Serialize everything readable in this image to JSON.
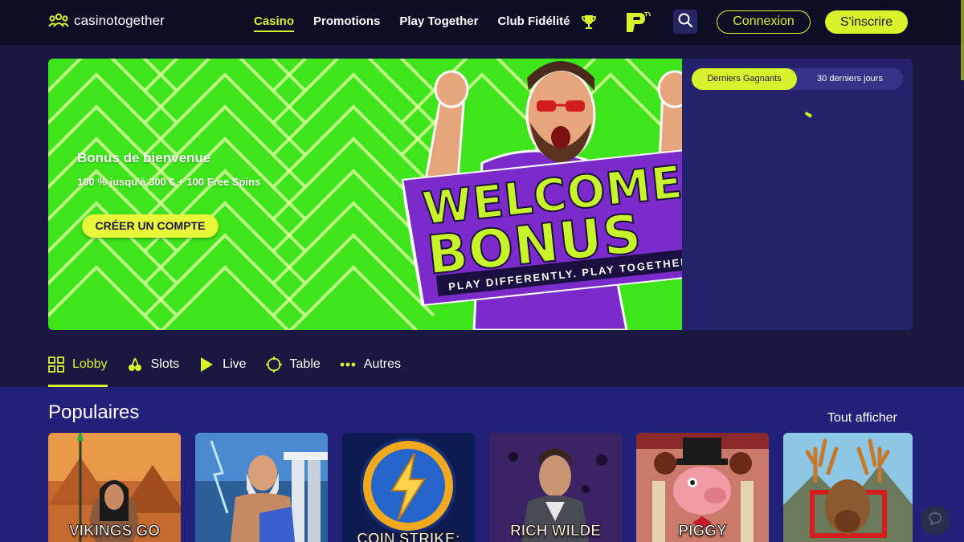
{
  "header": {
    "logo_text": "casinotogether",
    "nav": [
      "Casino",
      "Promotions",
      "Play Together",
      "Club Fidélité"
    ],
    "active_nav": "Casino",
    "login_label": "Connexion",
    "signup_label": "S'inscrire",
    "icons": [
      "logo-people-icon",
      "trophy-icon",
      "ptv-logo-icon",
      "search-icon"
    ]
  },
  "hero": {
    "title": "Bonus de bienvenue",
    "subtitle": "100 % jusqu'à 300 € + 100 Free Spins",
    "cta_label": "CRÉER UN COMPTE",
    "art_line1": "WELCOME",
    "art_line2": "BONUS",
    "art_tagline": "PLAY DIFFERENTLY. PLAY TOGETHER"
  },
  "winners": {
    "tab_active": "Derniers Gagnants",
    "tab_other": "30 derniers jours"
  },
  "categories": [
    {
      "label": "Lobby",
      "icon": "grid-icon",
      "active": true
    },
    {
      "label": "Slots",
      "icon": "cherries-icon",
      "active": false
    },
    {
      "label": "Live",
      "icon": "play-icon",
      "active": false
    },
    {
      "label": "Table",
      "icon": "chip-icon",
      "active": false
    },
    {
      "label": "Autres",
      "icon": "dots-icon",
      "active": false
    }
  ],
  "populaires": {
    "title": "Populaires",
    "see_all": "Tout afficher",
    "games": [
      {
        "title": "VIKINGS GO"
      },
      {
        "title": ""
      },
      {
        "title": "COIN STRIKE:"
      },
      {
        "title": "RICH WILDE"
      },
      {
        "title": "PIGGY"
      },
      {
        "title": ""
      }
    ]
  },
  "colors": {
    "accent": "#d8f22c",
    "background": "#1a1740",
    "header": "#0f0d26",
    "hero_green": "#3fe51b",
    "panel": "#24226a"
  }
}
